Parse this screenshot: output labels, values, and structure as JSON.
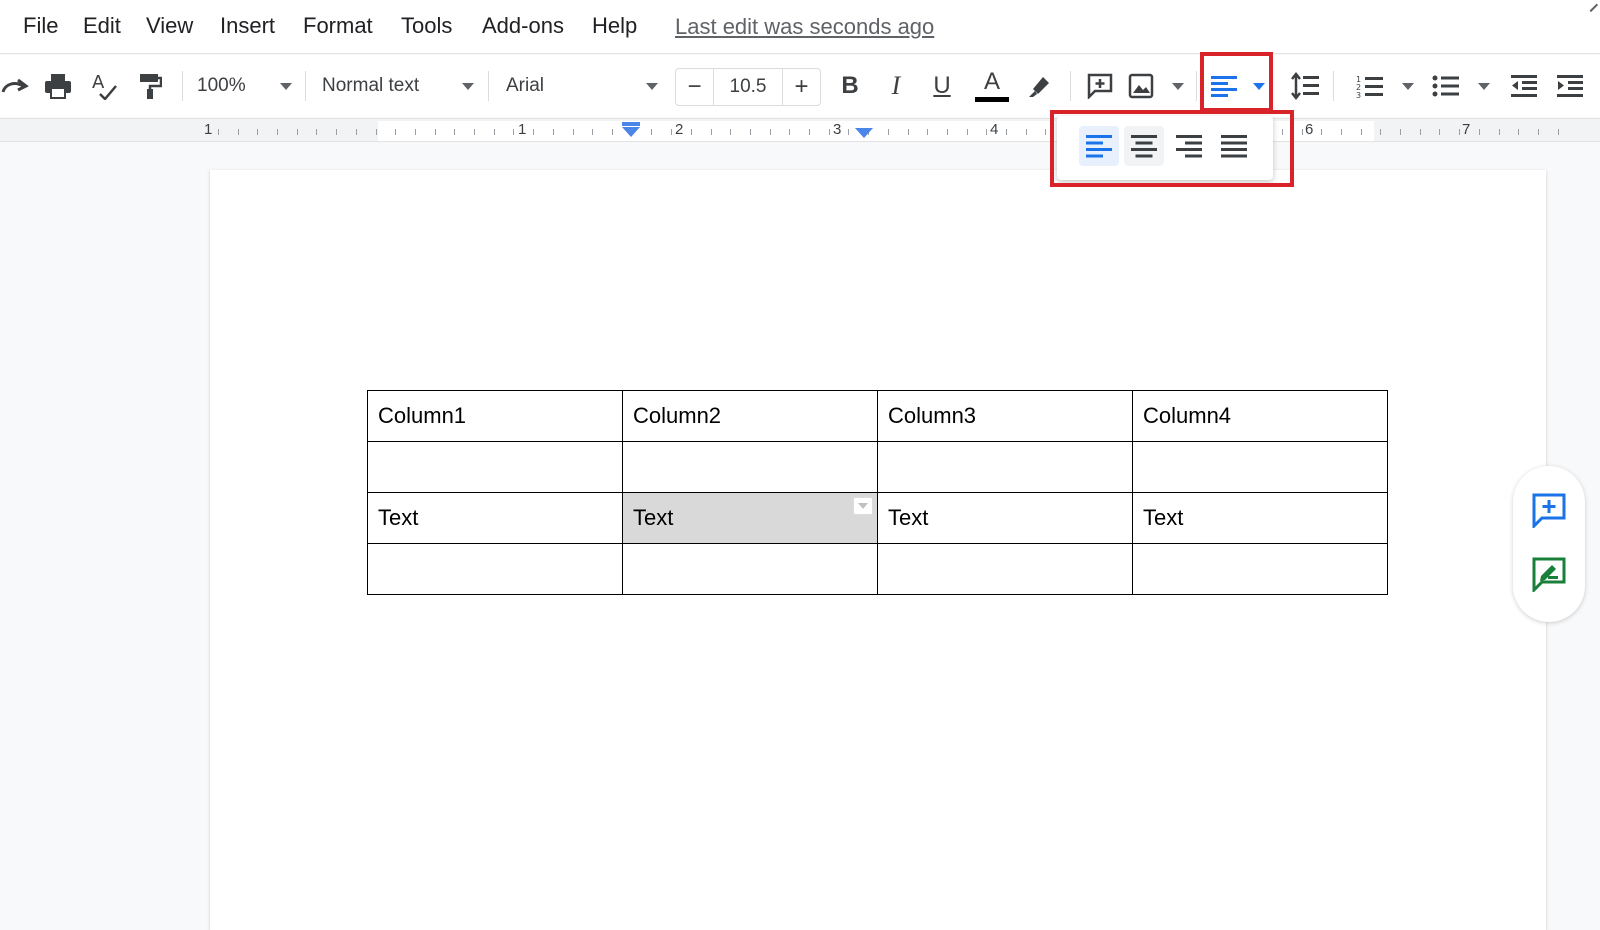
{
  "menu": {
    "items": [
      "File",
      "Edit",
      "View",
      "Insert",
      "Format",
      "Tools",
      "Add-ons",
      "Help"
    ],
    "last_edit": "Last edit was seconds ago"
  },
  "toolbar": {
    "zoom": "100%",
    "style": "Normal text",
    "font": "Arial",
    "font_size": "10.5",
    "minus_label": "−",
    "plus_label": "+",
    "icons": [
      "redo-icon",
      "print-icon",
      "spellcheck-icon",
      "paint-format-icon",
      "bold-icon",
      "italic-icon",
      "underline-icon",
      "text-color-icon",
      "highlight-icon",
      "add-comment-icon",
      "insert-image-icon",
      "align-left-icon",
      "line-spacing-icon",
      "numbered-list-icon",
      "bulleted-list-icon",
      "decrease-indent-icon",
      "increase-indent-icon"
    ],
    "bold_label": "B",
    "italic_label": "I",
    "underline_label": "U",
    "text_color_label": "A"
  },
  "ruler": {
    "numbers": [
      "1",
      "1",
      "2",
      "3",
      "4",
      "6",
      "7"
    ]
  },
  "table": {
    "rows": [
      [
        "Column1",
        "Column2",
        "Column3",
        "Column4"
      ],
      [
        "",
        "",
        "",
        ""
      ],
      [
        "Text",
        "Text",
        "Text",
        "Text"
      ],
      [
        "",
        "",
        "",
        ""
      ]
    ],
    "selected_cell": [
      2,
      1
    ]
  },
  "align_dropdown": {
    "options": [
      "align-left-icon",
      "align-center-icon",
      "align-right-icon",
      "justify-icon"
    ],
    "active": "align-left-icon"
  },
  "side_panel": {
    "buttons": [
      "add-comment-icon",
      "suggest-edit-icon"
    ]
  },
  "colors": {
    "accent_blue": "#1a73e8",
    "highlight_red": "#d8232a",
    "suggest_green": "#188038"
  }
}
